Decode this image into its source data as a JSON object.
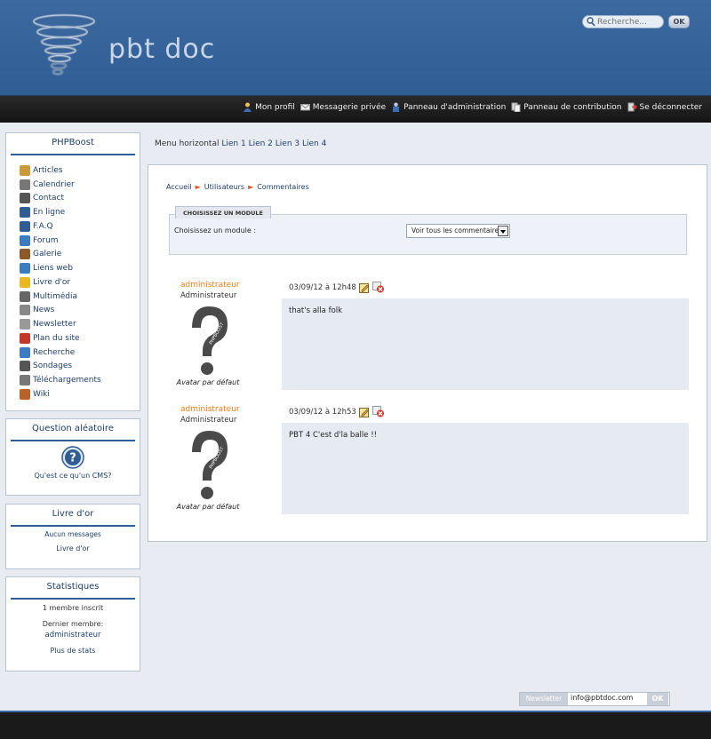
{
  "header": {
    "site_title": "pbt doc",
    "search_placeholder": "Recherche...",
    "search_button": "OK"
  },
  "topbar": {
    "links": [
      {
        "label": "Mon profil",
        "icon": "user-icon"
      },
      {
        "label": "Messagerie privée",
        "icon": "envelope-icon"
      },
      {
        "label": "Panneau d'administration",
        "icon": "admin-icon"
      },
      {
        "label": "Panneau de contribution",
        "icon": "contribution-icon"
      },
      {
        "label": "Se déconnecter",
        "icon": "logout-icon"
      }
    ]
  },
  "sidebar": {
    "phpboost": {
      "title": "PHPBoost",
      "items": [
        {
          "label": "Articles",
          "icon": "articles-icon",
          "color": "#c89b3c"
        },
        {
          "label": "Calendrier",
          "icon": "calendar-icon",
          "color": "#777777"
        },
        {
          "label": "Contact",
          "icon": "contact-icon",
          "color": "#555555"
        },
        {
          "label": "En ligne",
          "icon": "online-icon",
          "color": "#2f5d94"
        },
        {
          "label": "F.A.Q",
          "icon": "faq-icon",
          "color": "#2f5d94"
        },
        {
          "label": "Forum",
          "icon": "forum-icon",
          "color": "#3b7bbf"
        },
        {
          "label": "Galerie",
          "icon": "gallery-icon",
          "color": "#8a5a2a"
        },
        {
          "label": "Liens web",
          "icon": "weblinks-icon",
          "color": "#3b7bbf"
        },
        {
          "label": "Livre d'or",
          "icon": "guestbook-icon",
          "color": "#e8b923"
        },
        {
          "label": "Multimédia",
          "icon": "multimedia-icon",
          "color": "#666666"
        },
        {
          "label": "News",
          "icon": "news-icon",
          "color": "#888888"
        },
        {
          "label": "Newsletter",
          "icon": "newsletter-icon",
          "color": "#999999"
        },
        {
          "label": "Plan du site",
          "icon": "sitemap-icon",
          "color": "#c0392b"
        },
        {
          "label": "Recherche",
          "icon": "search-icon",
          "color": "#3b7bbf"
        },
        {
          "label": "Sondages",
          "icon": "polls-icon",
          "color": "#555555"
        },
        {
          "label": "Téléchargements",
          "icon": "downloads-icon",
          "color": "#777777"
        },
        {
          "label": "Wiki",
          "icon": "wiki-icon",
          "color": "#b8622a"
        }
      ]
    },
    "question": {
      "title": "Question aléatoire",
      "link": "Qu'est ce qu'un CMS?"
    },
    "guestbook": {
      "title": "Livre d'or",
      "message": "Aucun messages",
      "link": "Livre d'or"
    },
    "stats": {
      "title": "Statistiques",
      "members": "1 membre inscrit",
      "last_member_label": "Dernier membre:",
      "last_member": "administrateur",
      "more": "Plus de stats"
    }
  },
  "main": {
    "menu_label": "Menu horizontal",
    "menu_links": [
      "Lien 1",
      "Lien 2",
      "Lien 3",
      "Lien 4"
    ],
    "breadcrumb": [
      "Accueil",
      "Utilisateurs",
      "Commentaires"
    ],
    "module_tab": "CHOISISSEZ UN MODULE",
    "module_label": "Choisissez un module :",
    "module_selected": "Voir tous les commentaires",
    "comments": [
      {
        "author": "administrateur",
        "rank": "Administrateur",
        "avatar_caption": "Avatar par défaut",
        "date": "03/09/12 à 12h48",
        "text": "that's alla folk"
      },
      {
        "author": "administrateur",
        "rank": "Administrateur",
        "avatar_caption": "Avatar par défaut",
        "date": "03/09/12 à 12h53",
        "text": "PBT 4 C'est d'la balle !!"
      }
    ]
  },
  "footer": {
    "newsletter_label": "Newsletter",
    "newsletter_value": "info@pbtdoc.com",
    "newsletter_button": "OK"
  }
}
